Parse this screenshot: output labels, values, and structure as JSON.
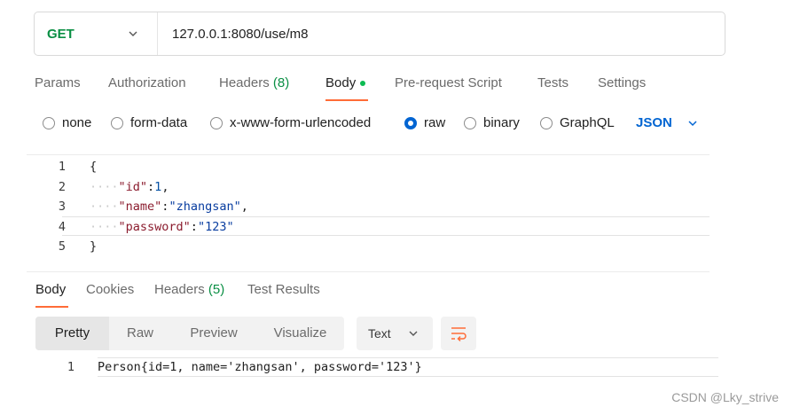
{
  "request": {
    "method": "GET",
    "url": "127.0.0.1:8080/use/m8"
  },
  "request_tabs": [
    {
      "label": "Params"
    },
    {
      "label": "Authorization"
    },
    {
      "label": "Headers",
      "count": "(8)"
    },
    {
      "label": "Body",
      "active": true
    },
    {
      "label": "Pre-request Script"
    },
    {
      "label": "Tests"
    },
    {
      "label": "Settings"
    }
  ],
  "body_types": {
    "options": [
      "none",
      "form-data",
      "x-www-form-urlencoded",
      "raw",
      "binary",
      "GraphQL"
    ],
    "selected": "raw",
    "language": "JSON"
  },
  "editor": {
    "lines": [
      {
        "num": "1",
        "text": "{"
      },
      {
        "num": "2",
        "indent": "····",
        "key": "\"id\"",
        "sep": ":",
        "value": "1",
        "value_type": "num",
        "tail": ","
      },
      {
        "num": "3",
        "indent": "····",
        "key": "\"name\"",
        "sep": ":",
        "value": "\"zhangsan\"",
        "value_type": "str",
        "tail": ","
      },
      {
        "num": "4",
        "indent": "····",
        "key": "\"password\"",
        "sep": ":",
        "value": "\"123\"",
        "value_type": "str",
        "tail": ""
      },
      {
        "num": "5",
        "text": "}"
      }
    ]
  },
  "response_tabs": [
    {
      "label": "Body",
      "active": true
    },
    {
      "label": "Cookies"
    },
    {
      "label": "Headers",
      "count": "(5)"
    },
    {
      "label": "Test Results"
    }
  ],
  "response_view": {
    "modes": [
      "Pretty",
      "Raw",
      "Preview",
      "Visualize"
    ],
    "selected": "Pretty",
    "format": "Text"
  },
  "response_body": {
    "num": "1",
    "text": "Person{id=1, name='zhangsan', password='123'}"
  },
  "watermark": "CSDN @Lky_strive",
  "colors": {
    "method_get": "#0a8f44",
    "accent_orange": "#ff6c37",
    "link_blue": "#0265d2",
    "active_dot": "#0cbb52"
  }
}
